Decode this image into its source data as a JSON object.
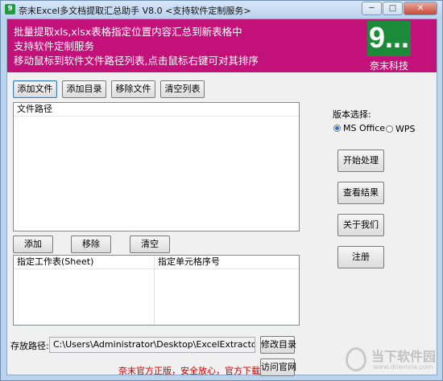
{
  "window": {
    "title": "奈末Excel多文档提取汇总助手 V8.0  <支持软件定制服务>",
    "app_icon": "9",
    "controls": {
      "minimize": "─",
      "maximize": "□",
      "close": "✕"
    }
  },
  "banner": {
    "lines": [
      "批量提取xls,xlsx表格指定位置内容汇总到新表格中",
      "支持软件定制服务",
      "移动鼠标到软件文件路径列表,点击鼠标右键可对其排序"
    ],
    "logo_mark": "9...",
    "logo_text": "奈末科技",
    "background_color": "#c2127a"
  },
  "file_toolbar": {
    "add_file": "添加文件",
    "add_dir": "添加目录",
    "remove_file": "移除文件",
    "clear_list": "清空列表"
  },
  "file_list": {
    "header": "文件路径",
    "rows": []
  },
  "sheet_toolbar": {
    "add": "添加",
    "remove": "移除",
    "clear": "清空"
  },
  "sheet_list": {
    "headers": [
      "指定工作表(Sheet)",
      "指定单元格序号"
    ],
    "rows": []
  },
  "version": {
    "label": "版本选择:",
    "options": [
      {
        "label": "MS Office",
        "selected": true
      },
      {
        "label": "WPS",
        "selected": false
      }
    ]
  },
  "actions": {
    "start": "开始处理",
    "view_result": "查看结果",
    "about": "关于我们",
    "register": "注册"
  },
  "output": {
    "label": "存放路径:",
    "path": "C:\\Users\\Administrator\\Desktop\\ExcelExtractor",
    "modify_dir": "修改目录"
  },
  "footer": {
    "notice": "奈末官方正版，安全放心，官方下载-->>",
    "visit_site": "访问官网"
  },
  "watermark": {
    "title": "当下软件园",
    "url": "www.downxia.com"
  }
}
